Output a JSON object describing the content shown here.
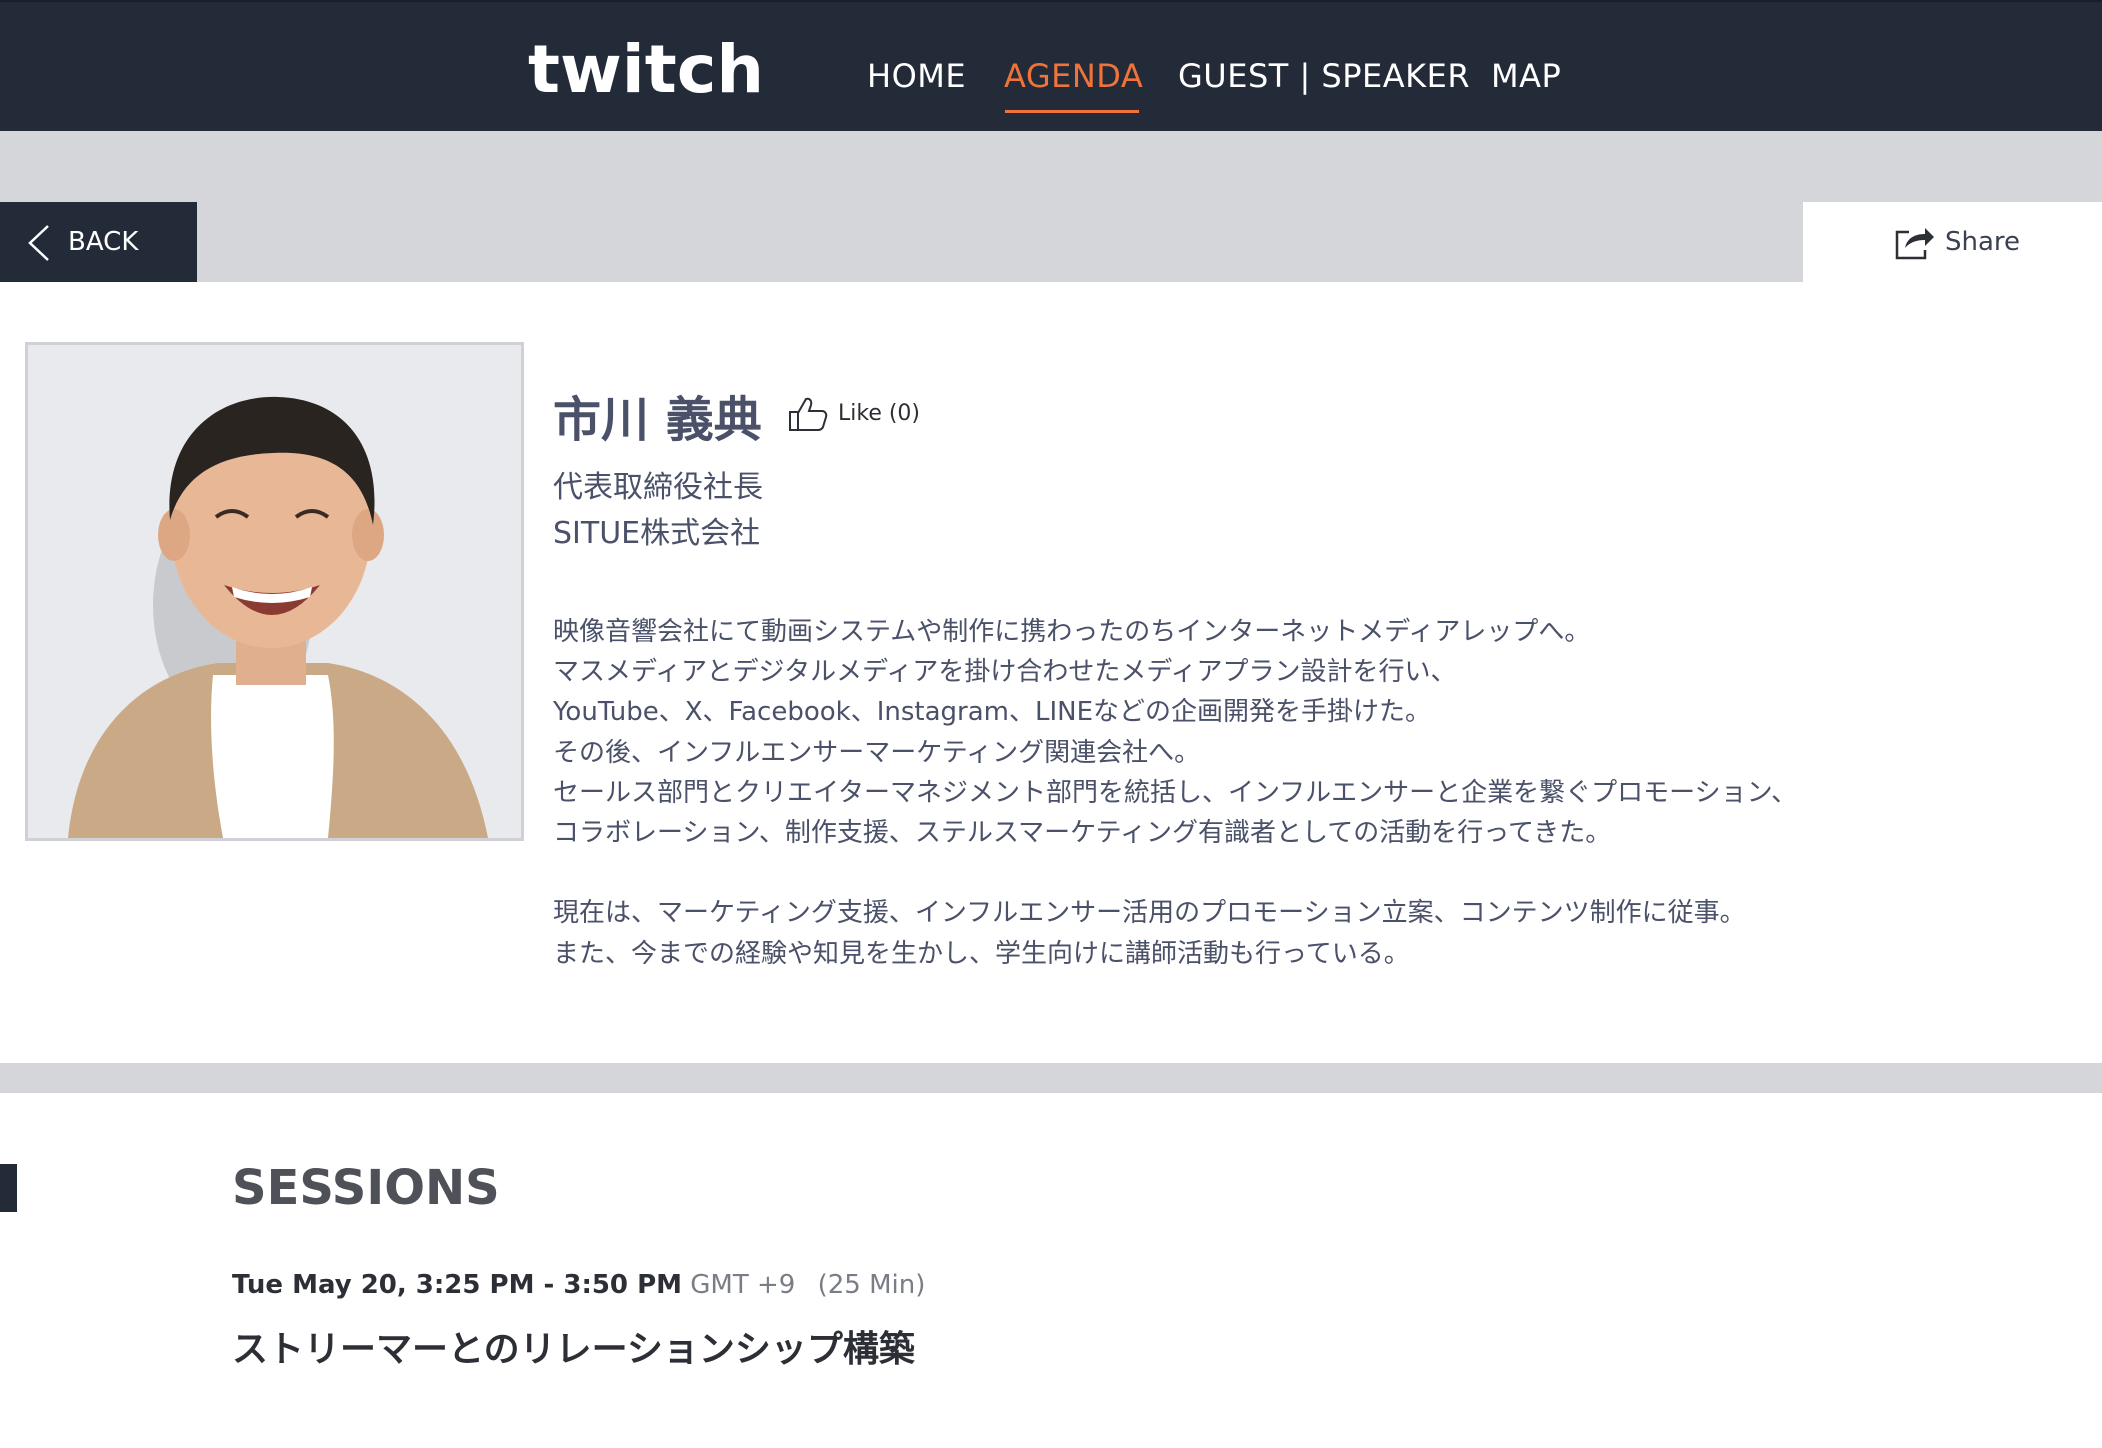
{
  "header": {
    "logo_text": "twitch",
    "nav": [
      {
        "label": "HOME",
        "active": false
      },
      {
        "label": "AGENDA",
        "active": true
      },
      {
        "label": "GUEST | SPEAKER",
        "active": false
      },
      {
        "label": "MAP",
        "active": false
      }
    ],
    "accent_color": "#f0733a",
    "background_color": "#232b39"
  },
  "toolbar": {
    "back_label": "BACK",
    "share_label": "Share"
  },
  "speaker": {
    "name": "市川 義典",
    "like_label": "Like (0)",
    "role": "代表取締役社長",
    "company": "SITUE株式会社",
    "bio_lines": [
      "映像音響会社にて動画システムや制作に携わったのちインターネットメディアレップへ。",
      "マスメディアとデジタルメディアを掛け合わせたメディアプラン設計を行い、",
      "YouTube、X、Facebook、Instagram、LINEなどの企画開発を手掛けた。",
      "その後、インフルエンサーマーケティング関連会社へ。",
      "セールス部門とクリエイターマネジメント部門を統括し、インフルエンサーと企業を繋ぐプロモーション、",
      "コラボレーション、制作支援、ステルスマーケティング有識者としての活動を行ってきた。",
      "",
      "現在は、マーケティング支援、インフルエンサー活用のプロモーション立案、コンテンツ制作に従事。",
      "また、今までの経験や知見を生かし、学生向けに講師活動も行っている。"
    ]
  },
  "sessions": {
    "heading": "SESSIONS",
    "items": [
      {
        "time": "Tue May 20, 3:25 PM - 3:50 PM",
        "timezone": "GMT +9",
        "duration": "(25 Min)",
        "title": "ストリーマーとのリレーションシップ構築"
      }
    ]
  }
}
